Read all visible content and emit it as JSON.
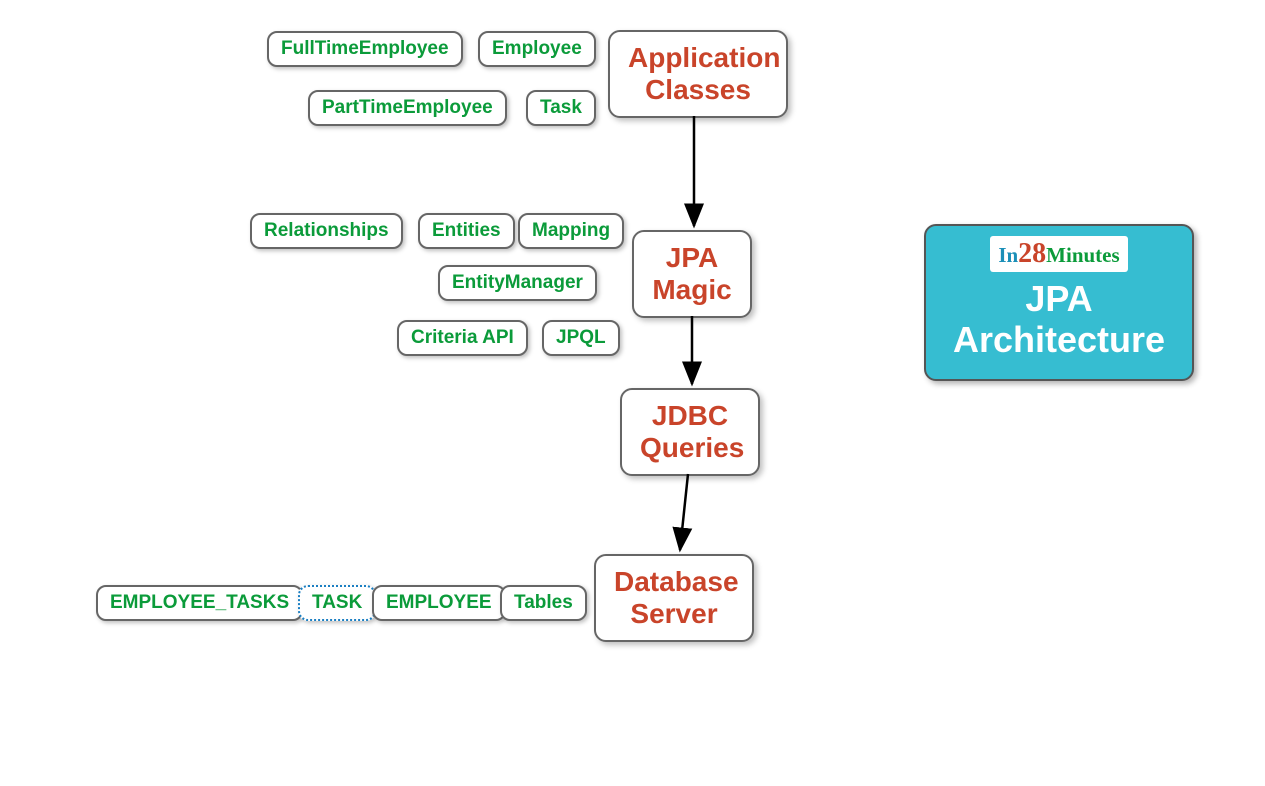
{
  "mainNodes": {
    "applicationClasses": {
      "line1": "Application",
      "line2": "Classes"
    },
    "jpaMagic": {
      "line1": "JPA",
      "line2": "Magic"
    },
    "jdbcQueries": {
      "line1": "JDBC",
      "line2": "Queries"
    },
    "databaseServer": {
      "line1": "Database",
      "line2": "Server"
    }
  },
  "appClassesSubs": {
    "fullTimeEmployee": "FullTimeEmployee",
    "employee": "Employee",
    "partTimeEmployee": "PartTimeEmployee",
    "task": "Task"
  },
  "jpaMagicSubs": {
    "relationships": "Relationships",
    "entities": "Entities",
    "mapping": "Mapping",
    "entityManager": "EntityManager",
    "criteriaApi": "Criteria API",
    "jpql": "JPQL"
  },
  "databaseSubs": {
    "employeeTasks": "EMPLOYEE_TASKS",
    "taskTable": "TASK",
    "employeeTable": "EMPLOYEE",
    "tables": "Tables"
  },
  "titleBox": {
    "brand1": "In",
    "brand2": "28",
    "brand3": "Minutes",
    "line1": "JPA",
    "line2": "Architecture"
  }
}
